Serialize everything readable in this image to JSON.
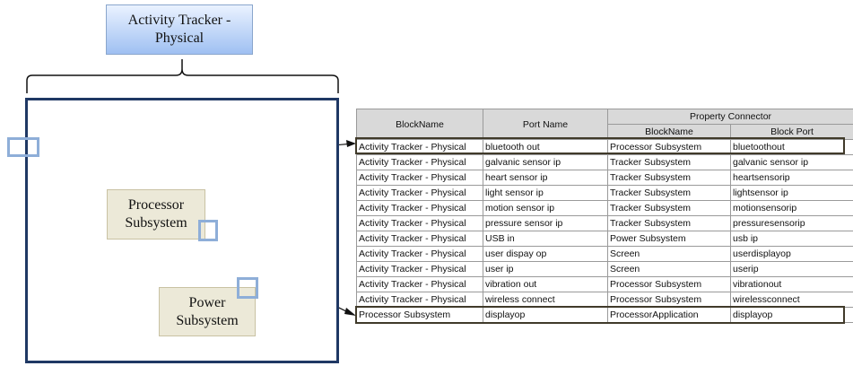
{
  "diagram": {
    "title": "Activity Tracker - Physical",
    "processor_label": "Processor Subsystem",
    "power_label": "Power Subsystem"
  },
  "table": {
    "headers": {
      "block_name": "BlockName",
      "port_name": "Port Name",
      "property_connector": "Property Connector",
      "pc_block_name": "BlockName",
      "pc_block_port": "Block Port"
    },
    "rows": [
      [
        "Activity Tracker - Physical",
        "bluetooth out",
        "Processor Subsystem",
        "bluetoothout"
      ],
      [
        "Activity Tracker - Physical",
        "galvanic sensor ip",
        "Tracker Subsystem",
        "galvanic sensor ip"
      ],
      [
        "Activity Tracker - Physical",
        "heart sensor ip",
        "Tracker Subsystem",
        "heartsensorip"
      ],
      [
        "Activity Tracker - Physical",
        "light sensor ip",
        "Tracker Subsystem",
        "lightsensor ip"
      ],
      [
        "Activity Tracker - Physical",
        "motion sensor ip",
        "Tracker Subsystem",
        "motionsensorip"
      ],
      [
        "Activity Tracker - Physical",
        "pressure sensor ip",
        "Tracker Subsystem",
        "pressuresensorip"
      ],
      [
        "Activity Tracker - Physical",
        "USB in",
        "Power Subsystem",
        "usb ip"
      ],
      [
        "Activity Tracker - Physical",
        "user dispay op",
        "Screen",
        "userdisplayop"
      ],
      [
        "Activity Tracker - Physical",
        "user ip",
        "Screen",
        "userip"
      ],
      [
        "Activity Tracker - Physical",
        "vibration out",
        "Processor Subsystem",
        "vibrationout"
      ],
      [
        "Activity Tracker - Physical",
        "wireless connect",
        "Processor Subsystem",
        "wirelessconnect"
      ],
      [
        "Processor Subsystem",
        "displayop",
        "ProcessorApplication",
        "displayop"
      ]
    ]
  }
}
